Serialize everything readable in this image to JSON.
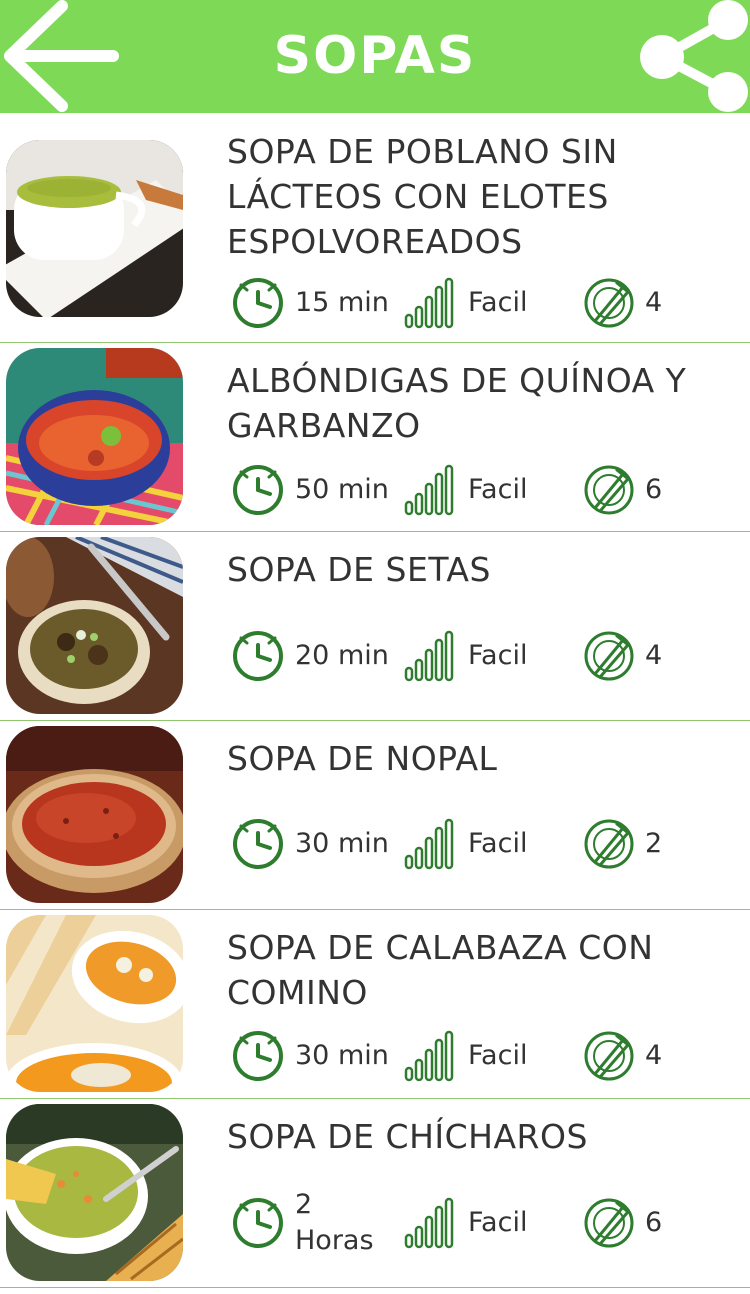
{
  "header": {
    "title": "SOPAS",
    "bg_color": "#7ed957",
    "back_icon": "arrow-left-icon",
    "share_icon": "share-icon"
  },
  "accent_color": "#2e7d2e",
  "recipes": [
    {
      "title": "SOPA DE POBLANO SIN LÁCTEOS CON ELOTES ESPOLVOREADOS",
      "time": "15 min",
      "difficulty": "Facil",
      "servings": "4",
      "image": "green-poblano-soup-cup"
    },
    {
      "title": "ALBÓNDIGAS DE QUÍNOA Y GARBANZO",
      "time": "50 min",
      "difficulty": "Facil",
      "servings": "6",
      "image": "red-meatball-soup-blue-bowl"
    },
    {
      "title": "SOPA DE SETAS",
      "time": "20 min",
      "difficulty": "Facil",
      "servings": "4",
      "image": "mushroom-soup-bowl"
    },
    {
      "title": "SOPA DE NOPAL",
      "time": "30 min",
      "difficulty": "Facil",
      "servings": "2",
      "image": "red-nopal-soup-bowl"
    },
    {
      "title": "SOPA DE CALABAZA CON COMINO",
      "time": "30 min",
      "difficulty": "Facil",
      "servings": "4",
      "image": "orange-pumpkin-soup-bowls"
    },
    {
      "title": "SOPA DE CHÍCHAROS",
      "time": "2 Horas",
      "difficulty": "Facil",
      "servings": "6",
      "image": "green-pea-soup-with-toast"
    }
  ]
}
